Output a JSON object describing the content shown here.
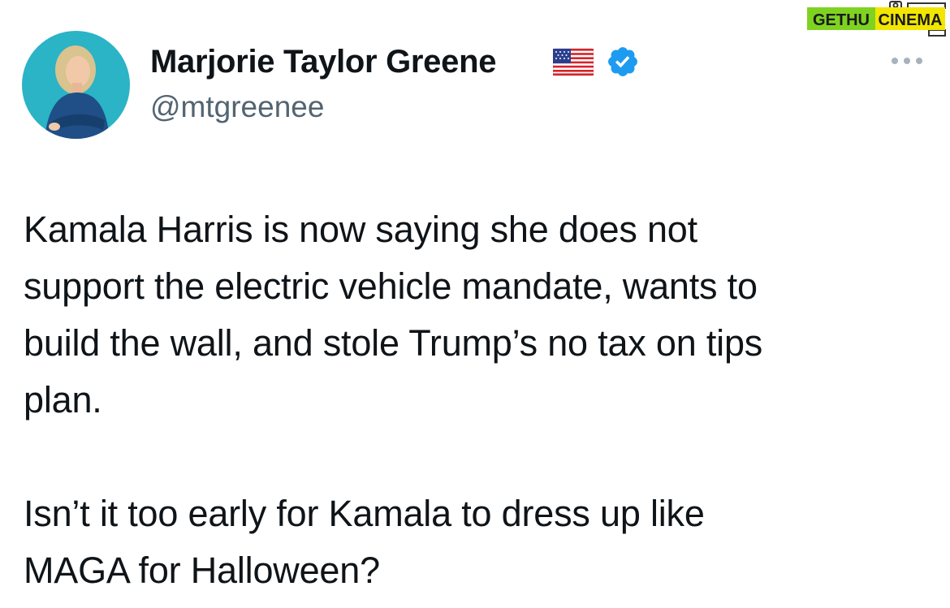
{
  "watermark": {
    "brand_left": "GETHU",
    "brand_right": "CINEMA",
    "green": "#7ed321",
    "yellow": "#f2e600"
  },
  "author": {
    "display_name": "Marjorie Taylor Greene",
    "handle": "@mtgreenee",
    "flag_icon": "us-flag-icon",
    "verified_icon": "verified-badge-icon",
    "verified_color": "#1d9bf0",
    "avatar_bg": "#2bb3c6"
  },
  "more_icon": "ellipsis-icon",
  "tweet": {
    "paragraph_1": "Kamala Harris is now saying she does not\nsupport the electric vehicle mandate, wants to\nbuild the wall, and stole Trump’s no tax on tips\nplan.",
    "paragraph_2": "Isn’t it too early for Kamala to dress up like\nMAGA for Halloween?"
  }
}
